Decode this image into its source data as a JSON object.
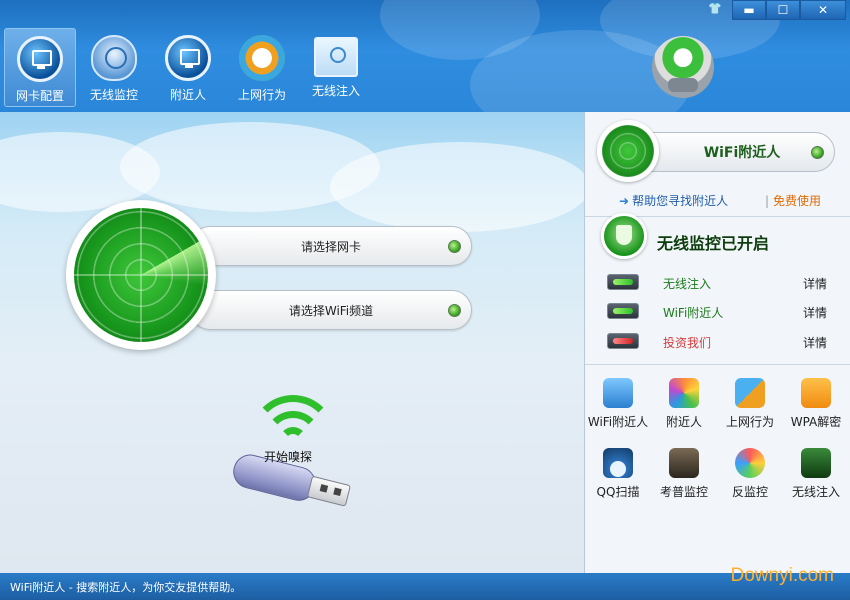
{
  "window": {
    "controls": [
      "▬",
      "☐",
      "✕"
    ],
    "skin_icon": "shirt-icon"
  },
  "nav": {
    "items": [
      {
        "label": "网卡配置",
        "icon": "network-card-icon",
        "active": true
      },
      {
        "label": "无线监控",
        "icon": "shield-radar-icon",
        "active": false
      },
      {
        "label": "附近人",
        "icon": "monitor-globe-icon",
        "active": false
      },
      {
        "label": "上网行为",
        "icon": "browser-orbit-icon",
        "active": false
      },
      {
        "label": "无线注入",
        "icon": "screen-inject-icon",
        "active": false
      }
    ]
  },
  "main": {
    "select_card": "请选择网卡",
    "select_channel": "请选择WiFi频道",
    "sniff_label": "开始嗅探"
  },
  "right_panel": {
    "wifi_nearby_title": "WiFi附近人",
    "help_link": "帮助您寻找附近人",
    "free_use": "免费使用",
    "separator": "|",
    "monitor_status": "无线监控已开启",
    "status_rows": [
      {
        "label": "无线注入",
        "detail": "详情",
        "state": "green"
      },
      {
        "label": "WiFi附近人",
        "detail": "详情",
        "state": "green"
      },
      {
        "label": "投资我们",
        "detail": "详情",
        "state": "red"
      }
    ],
    "tools": [
      {
        "label": "WiFi附近人",
        "icon": "cloud-icon"
      },
      {
        "label": "附近人",
        "icon": "people-icon"
      },
      {
        "label": "上网行为",
        "icon": "browser-icon"
      },
      {
        "label": "WPA解密",
        "icon": "lock-icon"
      },
      {
        "label": "QQ扫描",
        "icon": "qq-scan-icon"
      },
      {
        "label": "考普监控",
        "icon": "camera-icon"
      },
      {
        "label": "反监控",
        "icon": "anti-monitor-icon"
      },
      {
        "label": "无线注入",
        "icon": "inject-icon"
      }
    ]
  },
  "statusbar": {
    "text": "WiFi附近人 - 搜索附近人，为你交友提供帮助。"
  },
  "watermark": "Downyi.com",
  "colors": {
    "accent": "#2a86d8",
    "green": "#2fbf2c",
    "link": "#1f5da8",
    "orange": "#e06a00"
  }
}
